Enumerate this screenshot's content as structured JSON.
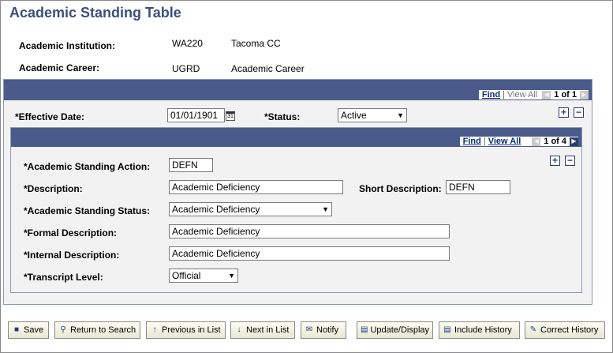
{
  "page": {
    "title": "Academic Standing Table"
  },
  "header": {
    "institution_label": "Academic Institution:",
    "institution_code": "WA220",
    "institution_name": "Tacoma CC",
    "career_label": "Academic Career:",
    "career_code": "UGRD",
    "career_name": "Academic Career"
  },
  "outer": {
    "find": "Find",
    "view_all": "View All",
    "count": "1 of 1",
    "effective_date_label": "*Effective Date:",
    "effective_date": "01/01/1901",
    "status_label": "*Status:",
    "status": "Active"
  },
  "inner": {
    "find": "Find",
    "view_all": "View All",
    "count": "1 of 4",
    "action_label": "*Academic Standing Action:",
    "action": "DEFN",
    "description_label": "*Description:",
    "description": "Academic Deficiency",
    "short_desc_label": "Short Description:",
    "short_desc": "DEFN",
    "standing_status_label": "*Academic Standing Status:",
    "standing_status": "Academic Deficiency",
    "formal_desc_label": "*Formal Description:",
    "formal_desc": "Academic Deficiency",
    "internal_desc_label": "*Internal Description:",
    "internal_desc": "Academic Deficiency",
    "transcript_level_label": "*Transcript Level:",
    "transcript_level": "Official"
  },
  "toolbar": {
    "save": "Save",
    "return_to_search": "Return to Search",
    "previous_in_list": "Previous in List",
    "next_in_list": "Next in List",
    "notify": "Notify",
    "update_display": "Update/Display",
    "include_history": "Include History",
    "correct_history": "Correct History"
  },
  "colors": {
    "title": "#3b4f7a",
    "bar": "#4a5a8a",
    "link": "#0a2a7a"
  },
  "icons": {
    "calendar": "calendar-icon",
    "add": "plus-icon",
    "delete": "minus-icon",
    "prev": "arrow-left-icon",
    "next": "arrow-right-icon",
    "dropdown": "chevron-down-icon"
  }
}
